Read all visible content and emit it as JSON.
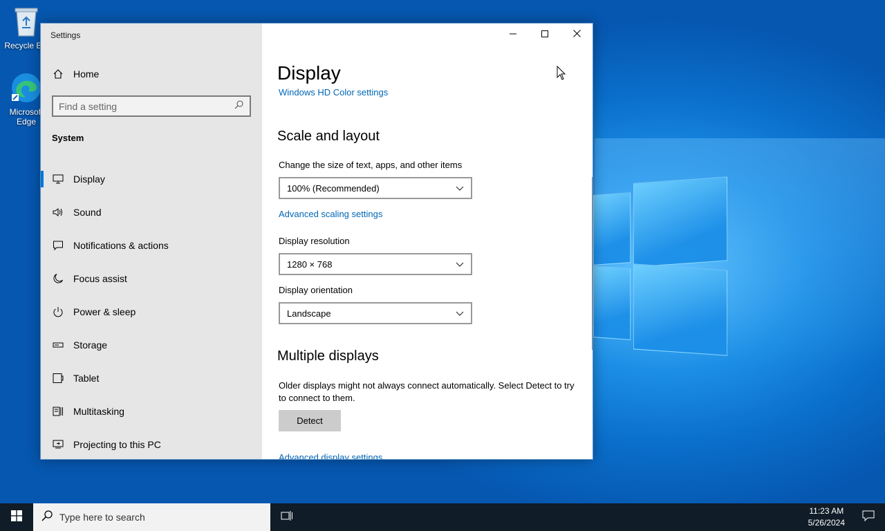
{
  "desktop": {
    "icons": [
      {
        "label": "Recycle Bin"
      },
      {
        "label": "Microsoft Edge"
      }
    ]
  },
  "window": {
    "title": "Settings",
    "sidebar": {
      "home_label": "Home",
      "search_placeholder": "Find a setting",
      "section_title": "System",
      "items": [
        {
          "label": "Display",
          "icon": "monitor-icon",
          "active": true
        },
        {
          "label": "Sound",
          "icon": "speaker-icon"
        },
        {
          "label": "Notifications & actions",
          "icon": "message-icon"
        },
        {
          "label": "Focus assist",
          "icon": "moon-icon"
        },
        {
          "label": "Power & sleep",
          "icon": "power-icon"
        },
        {
          "label": "Storage",
          "icon": "storage-icon"
        },
        {
          "label": "Tablet",
          "icon": "tablet-icon"
        },
        {
          "label": "Multitasking",
          "icon": "multitasking-icon"
        },
        {
          "label": "Projecting to this PC",
          "icon": "projector-icon"
        }
      ]
    },
    "content": {
      "page_title": "Display",
      "hd_color_link": "Windows HD Color settings",
      "scale_heading": "Scale and layout",
      "scale_label": "Change the size of text, apps, and other items",
      "scale_value": "100% (Recommended)",
      "advanced_scaling_link": "Advanced scaling settings",
      "resolution_label": "Display resolution",
      "resolution_value": "1280 × 768",
      "orientation_label": "Display orientation",
      "orientation_value": "Landscape",
      "multiple_heading": "Multiple displays",
      "multiple_desc": "Older displays might not always connect automatically. Select Detect to try to connect to them.",
      "detect_label": "Detect",
      "advanced_display_link": "Advanced display settings"
    }
  },
  "taskbar": {
    "search_placeholder": "Type here to search",
    "time": "11:23 AM",
    "date": "5/26/2024"
  },
  "colors": {
    "accent": "#0078d7",
    "link": "#0066b4",
    "taskbar": "#101c28",
    "sidebar": "#e6e6e6"
  }
}
